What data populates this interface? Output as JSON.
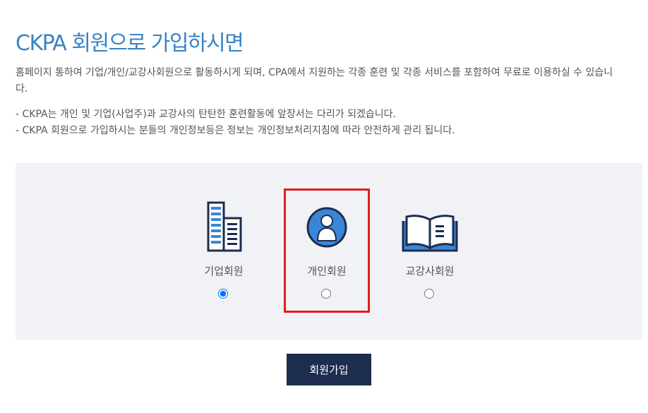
{
  "header": {
    "title": "CKPA 회원으로 가입하시면"
  },
  "intro": {
    "text": "홈페이지 통하여 기업/개인/교강사회원으로 활동하시게 되며, CPA에서 지원하는 각종 훈련 및 각종 서비스를 포함하여 무료로 이용하실 수 있습니다."
  },
  "notes": [
    "- CKPA는 개인 및 기업(사업주)과 교강사의 탄탄한 훈련활동에 앞장서는 다리가 되겠습니다.",
    "- CKPA 회원으로 가입하시는 분들의 개인정보등은 정보는 개인정보처리지침에 따라 안전하게 관리 됩니다."
  ],
  "member_types": [
    {
      "label": "기업회원",
      "icon": "building-icon",
      "selected": true
    },
    {
      "label": "개인회원",
      "icon": "person-icon",
      "selected": false
    },
    {
      "label": "교강사회원",
      "icon": "book-icon",
      "selected": false
    }
  ],
  "join_button": {
    "label": "회원가입"
  },
  "colors": {
    "title": "#3b82c4",
    "panel_bg": "#f1f2f6",
    "button_bg": "#1c2d4f",
    "highlight_border": "#e41b1b",
    "icon_dark": "#1c2d4f",
    "icon_accent": "#3a86d6"
  }
}
